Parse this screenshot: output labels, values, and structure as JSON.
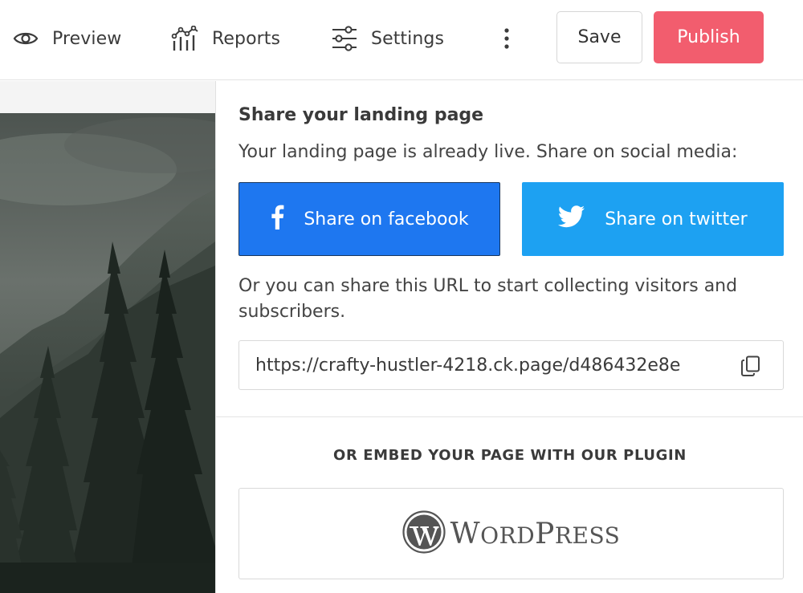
{
  "toolbar": {
    "preview_label": "Preview",
    "reports_label": "Reports",
    "settings_label": "Settings",
    "save_label": "Save",
    "publish_label": "Publish",
    "publish_color": "#f25d6e",
    "icons": [
      "eye-icon",
      "reports-icon",
      "sliders-icon",
      "more-vertical-icon"
    ]
  },
  "share_panel": {
    "title": "Share your landing page",
    "description": "Your landing page is already live. Share on social media:",
    "facebook_label": "Share on facebook",
    "facebook_color": "#1e77f0",
    "twitter_label": "Share on twitter",
    "twitter_color": "#1da1f2",
    "note": "Or you can share this URL to start collecting visitors and subscribers.",
    "url": "https://crafty-hustler-4218.ck.page/d486432e8e",
    "embed_heading": "OR EMBED YOUR PAGE WITH OUR PLUGIN",
    "plugin": {
      "logo_text": "WordPress",
      "logo_icon": "wordpress-icon"
    }
  },
  "canvas": {
    "image": "forest-mountain-photo"
  }
}
